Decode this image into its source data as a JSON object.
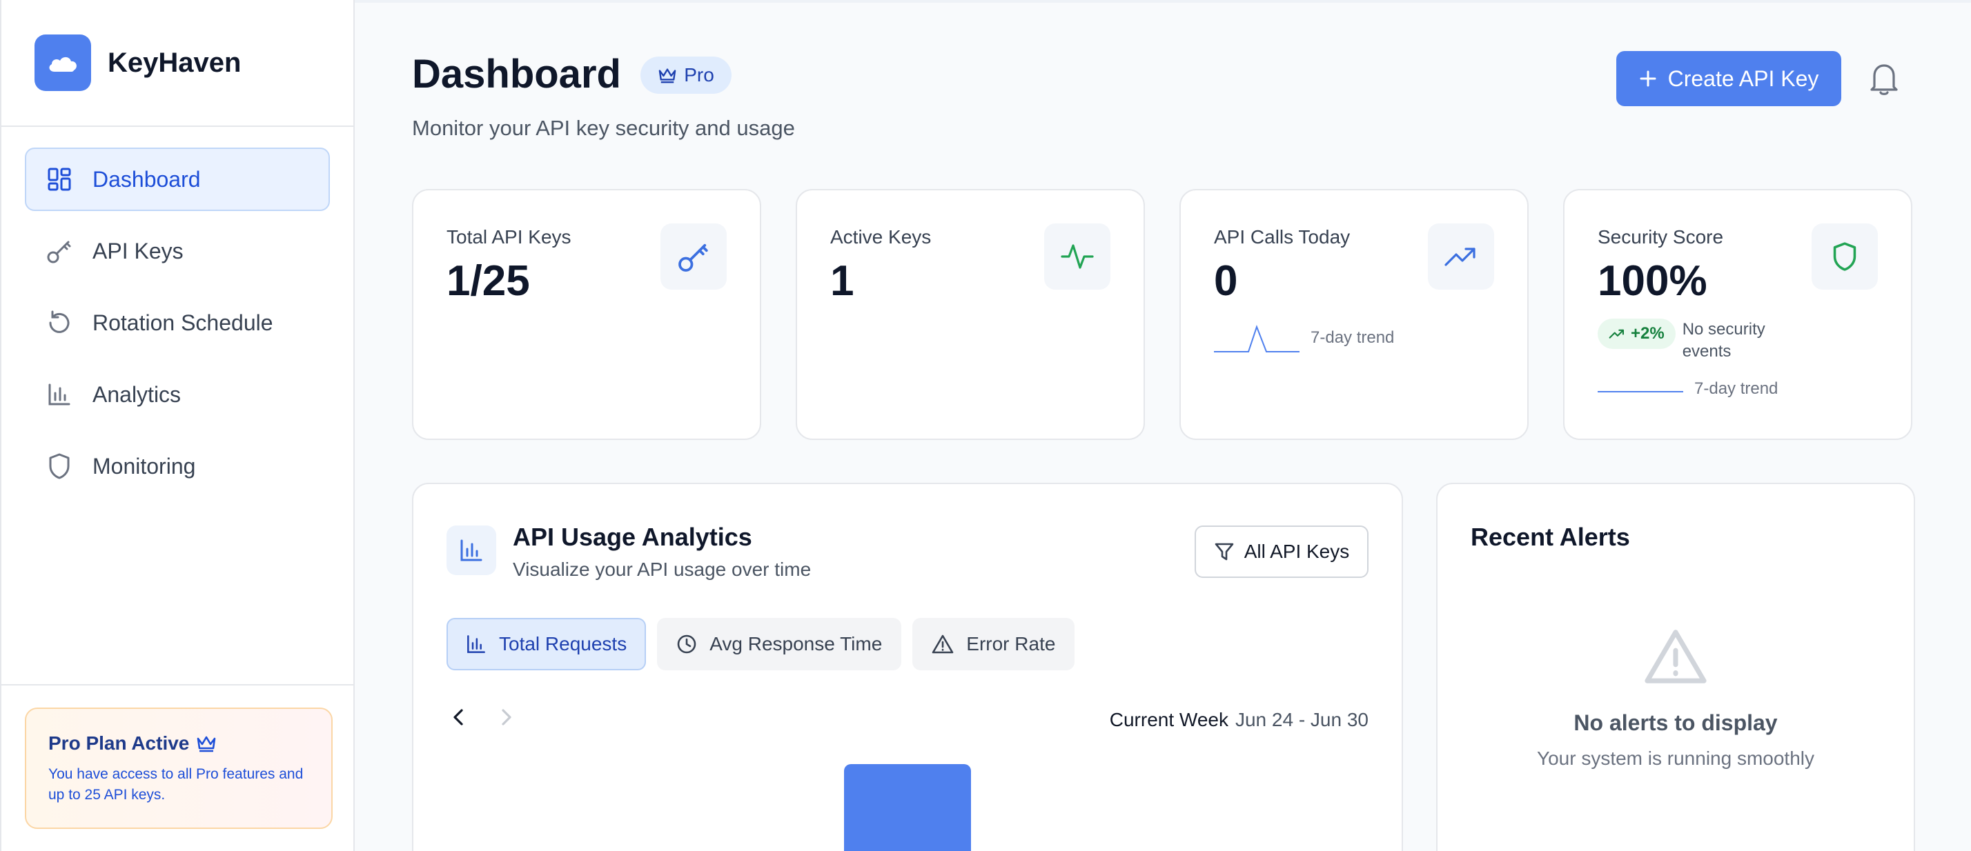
{
  "brand": {
    "name": "KeyHaven"
  },
  "sidebar": {
    "items": [
      {
        "label": "Dashboard",
        "icon": "dashboard-grid-icon",
        "active": true
      },
      {
        "label": "API Keys",
        "icon": "key-icon"
      },
      {
        "label": "Rotation Schedule",
        "icon": "rotate-icon"
      },
      {
        "label": "Analytics",
        "icon": "bar-chart-icon"
      },
      {
        "label": "Monitoring",
        "icon": "shield-icon"
      }
    ],
    "plan": {
      "title": "Pro Plan Active",
      "text": "You have access to all Pro features and up to 25 API keys."
    }
  },
  "header": {
    "title": "Dashboard",
    "badge": "Pro",
    "subtitle": "Monitor your API key security and usage",
    "create_label": "Create API Key"
  },
  "stats": [
    {
      "label": "Total API Keys",
      "value": "1/25",
      "icon": "key-icon"
    },
    {
      "label": "Active Keys",
      "value": "1",
      "icon": "activity-icon"
    },
    {
      "label": "API Calls Today",
      "value": "0",
      "icon": "trending-up-icon",
      "trend_label": "7-day trend"
    },
    {
      "label": "Security Score",
      "value": "100%",
      "icon": "shield-icon",
      "change": "+2%",
      "note": "No security events",
      "trend_label": "7-day trend"
    }
  ],
  "usage": {
    "title": "API Usage Analytics",
    "subtitle": "Visualize your API usage over time",
    "filter_label": "All API Keys",
    "tabs": [
      {
        "label": "Total Requests",
        "active": true
      },
      {
        "label": "Avg Response Time"
      },
      {
        "label": "Error Rate"
      }
    ],
    "week_label": "Current Week",
    "week_range": "Jun 24 - Jun 30"
  },
  "alerts": {
    "title": "Recent Alerts",
    "empty_title": "No alerts to display",
    "empty_sub": "Your system is running smoothly"
  },
  "colors": {
    "accent": "#4f80ee",
    "success": "#22a454",
    "background": "#f8fafc"
  }
}
